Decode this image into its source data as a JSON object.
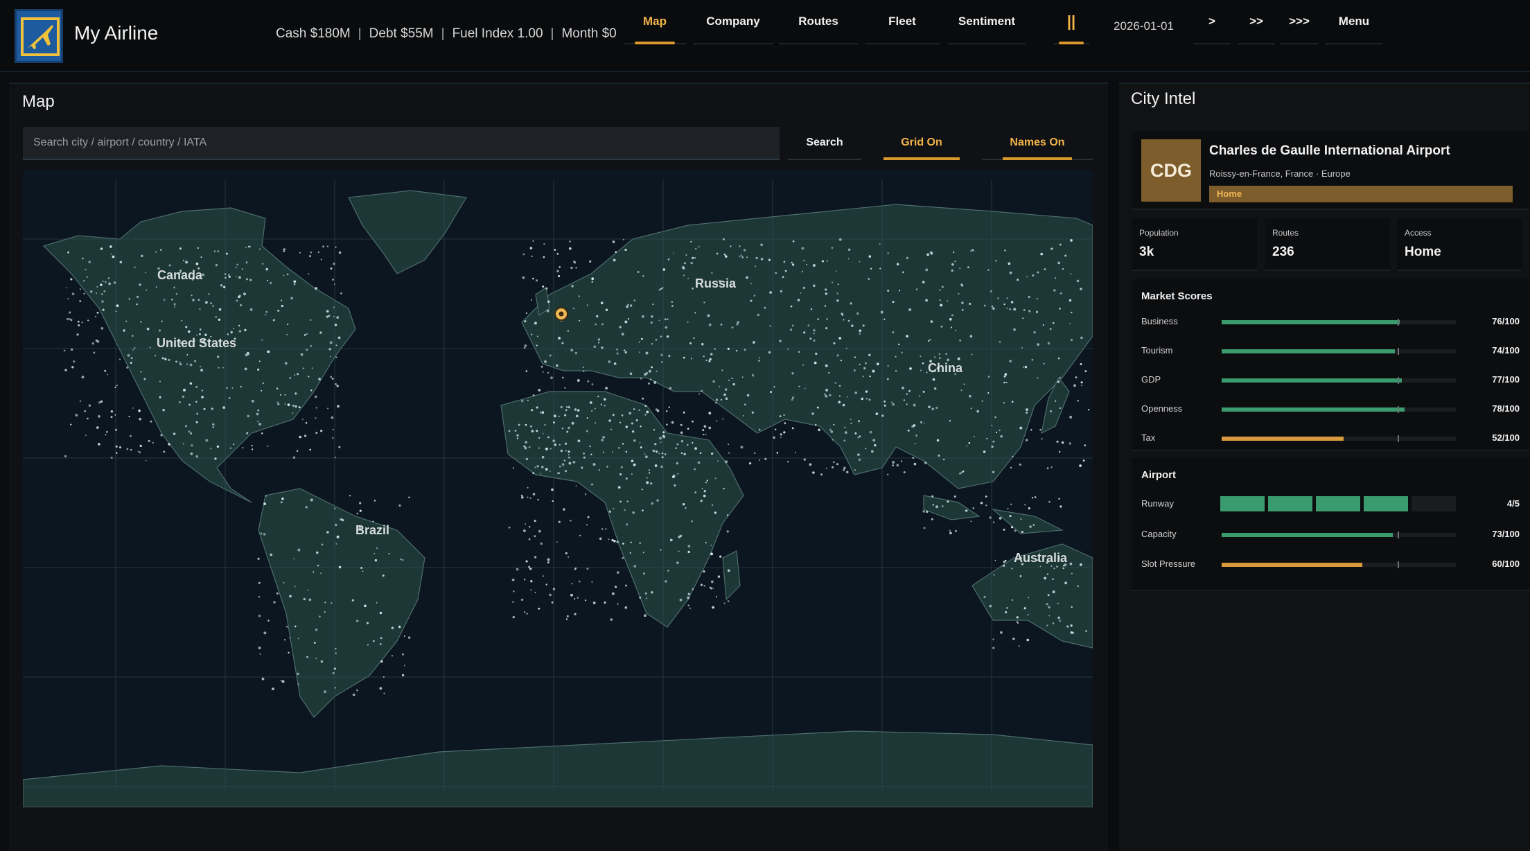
{
  "app": {
    "title": "My Airline"
  },
  "stats": {
    "cash": "Cash $180M",
    "debt": "Debt $55M",
    "fuel": "Fuel Index 1.00",
    "month": "Month $0"
  },
  "nav": [
    {
      "label": "Map",
      "active": true
    },
    {
      "label": "Company",
      "active": false
    },
    {
      "label": "Routes",
      "active": false
    },
    {
      "label": "Fleet",
      "active": false
    },
    {
      "label": "Sentiment",
      "active": false
    }
  ],
  "controls": {
    "pause": "||",
    "date": "2026-01-01",
    "speed1": ">",
    "speed2": ">>",
    "speed3": ">>>",
    "menu": "Menu"
  },
  "map_panel": {
    "title": "Map",
    "search_placeholder": "Search city / airport / country / IATA",
    "search_button": "Search",
    "grid_toggle": "Grid On",
    "names_toggle": "Names On",
    "region_labels": [
      "Canada",
      "United States",
      "Russia",
      "China",
      "Brazil",
      "Australia"
    ]
  },
  "intel": {
    "title": "City Intel",
    "code": "CDG",
    "name": "Charles de Gaulle International Airport",
    "location": "Roissy-en-France, France · Europe",
    "status": "Home",
    "population": {
      "label": "Population",
      "value": "3k"
    },
    "routes": {
      "label": "Routes",
      "value": "236"
    },
    "access": {
      "label": "Access",
      "value": "Home"
    },
    "market_title": "Market Scores",
    "market": [
      {
        "label": "Business",
        "value": "76/100",
        "score": 76,
        "color": "green"
      },
      {
        "label": "Tourism",
        "value": "74/100",
        "score": 74,
        "color": "green"
      },
      {
        "label": "GDP",
        "value": "77/100",
        "score": 77,
        "color": "green"
      },
      {
        "label": "Openness",
        "value": "78/100",
        "score": 78,
        "color": "green"
      },
      {
        "label": "Tax",
        "value": "52/100",
        "score": 52,
        "color": "orange"
      }
    ],
    "airport_title": "Airport",
    "runway": {
      "label": "Runway",
      "value": "4/5",
      "level": 4,
      "max": 5
    },
    "airport": [
      {
        "label": "Capacity",
        "value": "73/100",
        "score": 73,
        "color": "green"
      },
      {
        "label": "Slot Pressure",
        "value": "60/100",
        "score": 60,
        "color": "orange"
      }
    ]
  },
  "colors": {
    "accent": "#f3b44a",
    "green": "#3a9c6e",
    "orange": "#d99a3d",
    "land": "#1d3636",
    "ocean": "#0b1620"
  }
}
